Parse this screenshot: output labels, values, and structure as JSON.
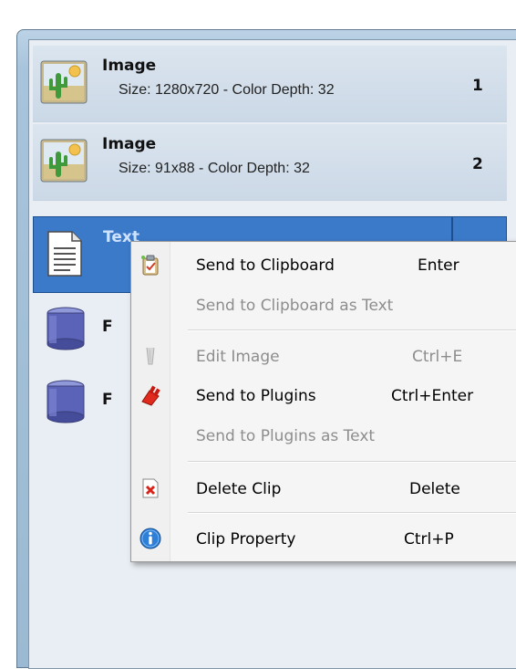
{
  "clips": [
    {
      "title": "Image",
      "info": "Size: 1280x720 - Color Depth: 32",
      "number": "1",
      "icon": "image-icon"
    },
    {
      "title": "Image",
      "info": "Size: 91x88 - Color Depth: 32",
      "number": "2",
      "icon": "image-icon"
    },
    {
      "title": "Text",
      "icon": "text-document-icon"
    },
    {
      "title": "F",
      "icon": "file-stack-icon"
    },
    {
      "title": "F",
      "icon": "file-stack-icon"
    }
  ],
  "menu": {
    "items": [
      {
        "label": "Send to Clipboard",
        "shortcut": "Enter",
        "enabled": true,
        "icon": "clipboard-icon"
      },
      {
        "label": "Send to Clipboard as Text",
        "shortcut": "",
        "enabled": false
      },
      {
        "label": "Edit Image",
        "shortcut": "Ctrl+E",
        "enabled": false,
        "icon": "edit-image-icon"
      },
      {
        "label": "Send to Plugins",
        "shortcut": "Ctrl+Enter",
        "enabled": true,
        "icon": "plugin-icon"
      },
      {
        "label": "Send to Plugins as Text",
        "shortcut": "",
        "enabled": false
      },
      {
        "label": "Delete Clip",
        "shortcut": "Delete",
        "enabled": true,
        "icon": "delete-icon"
      },
      {
        "label": "Clip Property",
        "shortcut": "Ctrl+P",
        "enabled": true,
        "icon": "info-icon"
      }
    ]
  },
  "colors": {
    "selection": "#3b7ac9",
    "menu_bg": "#f5f5f5",
    "disabled_text": "#8d8d8d"
  }
}
